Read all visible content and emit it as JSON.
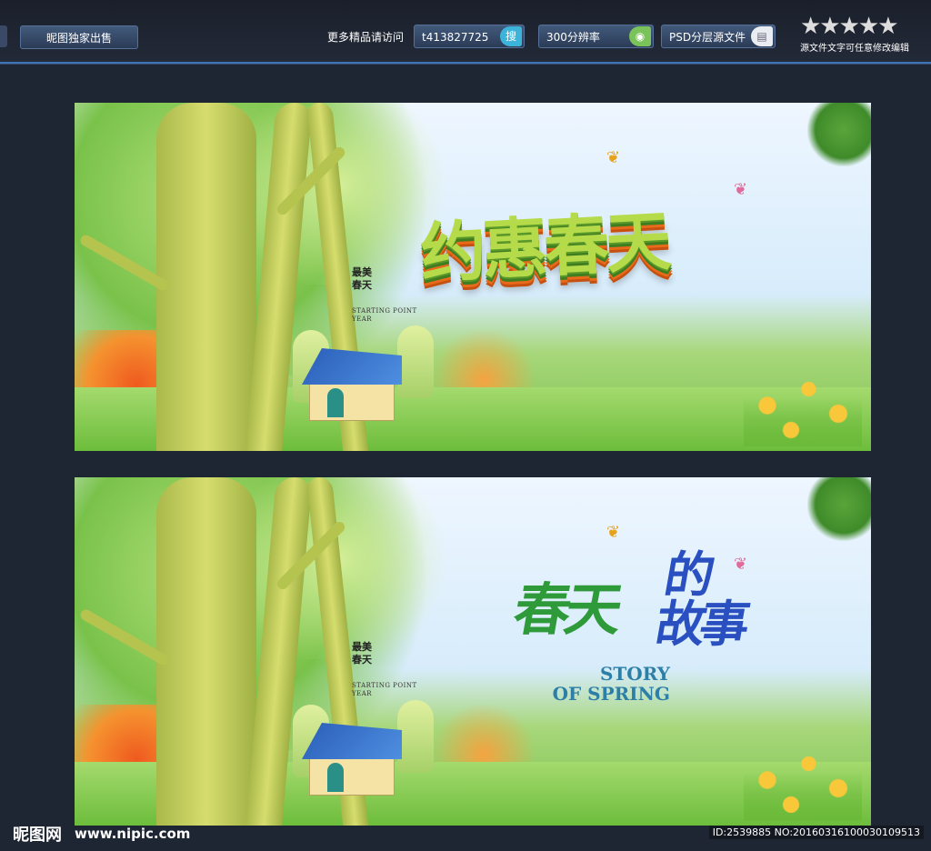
{
  "topbar": {
    "exclusive_label": "昵图独家出售",
    "visit_label": "更多精品请访问",
    "qq_label": "t413827725",
    "qq_icon": "搜",
    "resolution_label": "300分辨率",
    "psd_label": "PSD分层源文件",
    "stars": "★★★★★",
    "stars_note": "源文件文字可任意修改编辑"
  },
  "banner1": {
    "title": "约惠春天",
    "vertical_text": "最美\n春天",
    "small_en": "STARTING POINT\nYEAR"
  },
  "banner2": {
    "title_part1": "春天",
    "title_part2": "的\n故事",
    "title_en": "STORY\nOF SPRING",
    "vertical_text": "最美\n春天",
    "small_en": "STARTING POINT\nYEAR"
  },
  "footer": {
    "logo": "昵图网",
    "url": "www.nipic.com",
    "id_text": "ID:2539885 NO:20160316100030109513"
  },
  "colors": {
    "background": "#1e2533",
    "accent_line": "#3d76b8"
  }
}
